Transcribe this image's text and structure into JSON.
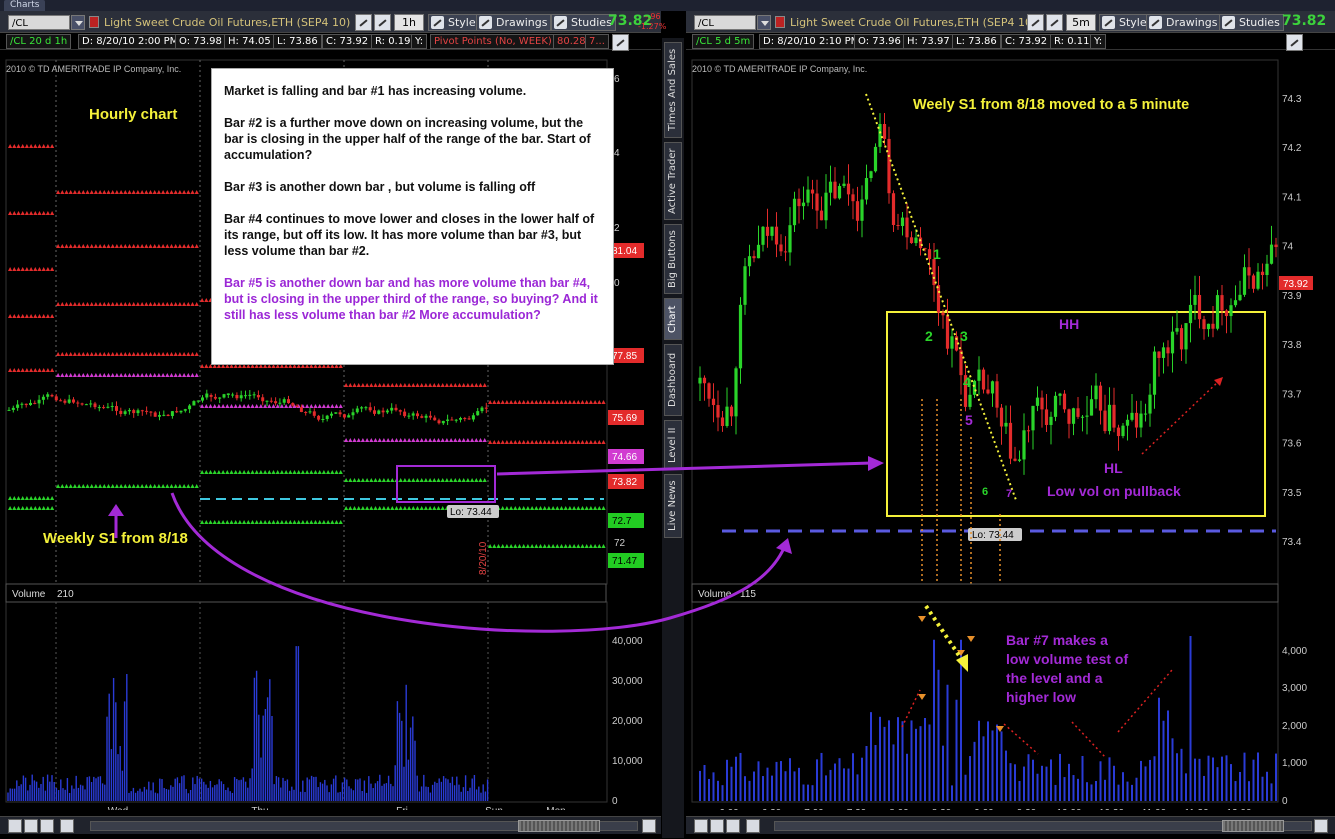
{
  "app": {
    "tab_label": "Charts"
  },
  "left": {
    "symbol": "/CL",
    "description": "Light Sweet Crude Oil Futures,ETH (SEP4 10)",
    "timeframe": "1h",
    "style_label": "Style",
    "drawings_label": "Drawings",
    "studies_label": "Studies",
    "last_price": "73.82",
    "change_top": "-.96",
    "change_bottom": "-1.27%",
    "info": {
      "aggregation": "/CL 20 d 1h",
      "date": "D: 8/20/10 2:00 PM",
      "open": "O: 73.98",
      "high": "H: 74.05",
      "low": "L: 73.86",
      "close": "C: 73.92",
      "range": "R: 0.19",
      "y": "Y:",
      "pivot": "Pivot Points (No, WEEK)",
      "pivot_v1": "80.28",
      "pivot_v2": "7..."
    },
    "copyright": "2010 © TD AMERITRADE IP Company, Inc.",
    "chart_label": "Hourly chart",
    "weekly_label": "Weekly S1 from 8/18",
    "date_marker": "8/20/10",
    "lo_label": "Lo: 73.44",
    "volume_label": "Volume",
    "volume_value": "210",
    "time_labels": [
      "Wed",
      "Thu",
      "Fri",
      "Sun",
      "Mon"
    ],
    "vol_axis": [
      "40,000",
      "30,000",
      "20,000",
      "10,000",
      "0"
    ],
    "pivot_tags": [
      {
        "v": "81.04",
        "c": "#e32b2b",
        "tc": "#fff"
      },
      {
        "v": "77.85",
        "c": "#e32b2b",
        "tc": "#fff"
      },
      {
        "v": "75.69",
        "c": "#e32b2b",
        "tc": "#fff"
      },
      {
        "v": "74.66",
        "c": "#d13bd1",
        "tc": "#fff"
      },
      {
        "v": "73.82",
        "c": "#e32b2b",
        "tc": "#fff"
      },
      {
        "v": "72.7",
        "c": "#22cc22",
        "tc": "#000"
      },
      {
        "v": "71.47",
        "c": "#22cc22",
        "tc": "#000"
      }
    ],
    "axis_fragments": [
      "6",
      "4",
      "2",
      "0",
      "72"
    ]
  },
  "callout": {
    "p1": "Market is falling and bar #1 has increasing volume.",
    "p2": "Bar #2 is a further move down on increasing volume, but the bar is closing in the upper half of the range of the bar.  Start of accumulation?",
    "p3": "Bar #3 is another down bar , but volume is falling off",
    "p4": "Bar #4 continues to move lower and closes in the lower half of its range, but off its low.  It has more volume than bar #3, but less volume than bar #2.",
    "p5": "Bar #5 is another down  bar and has more volume than bar #4, but is closing in the upper third of the range, so buying? And it still has less volume than bar #2  More accumulation?"
  },
  "side_tabs": [
    "Times And Sales",
    "Active Trader",
    "Big Buttons",
    "Chart",
    "Dashboard",
    "Level II",
    "Live News"
  ],
  "right": {
    "symbol": "/CL",
    "description": "Light Sweet Crude Oil Futures,ETH (SEP4 10)",
    "timeframe": "5m",
    "style_label": "Style",
    "drawings_label": "Drawings",
    "studies_label": "Studies",
    "last_price": "73.82",
    "info": {
      "aggregation": "/CL 5 d 5m",
      "date": "D: 8/20/10 2:10 PM",
      "open": "O: 73.96",
      "high": "H: 73.97",
      "low": "L: 73.86",
      "close": "C: 73.92",
      "range": "R: 0.11",
      "y": "Y:"
    },
    "copyright": "2010 © TD AMERITRADE IP Company, Inc.",
    "title_annotation": "Weely S1 from 8/18 moved to a 5 minute",
    "bar_numbers": [
      "1",
      "2",
      "3",
      "4",
      "5",
      "6",
      "7"
    ],
    "hh_label": "HH",
    "hl_label": "HL",
    "low_vol_label": "Low vol on pullback",
    "lo_label": "Lo: 73.44",
    "last_tag": "73.92",
    "price_axis": [
      "74.3",
      "74.2",
      "74.1",
      "74",
      "73.9",
      "73.8",
      "73.7",
      "73.6",
      "73.5",
      "73.4"
    ],
    "volume_label": "Volume",
    "volume_value": "115",
    "vol_axis": [
      "4,000",
      "3,000",
      "2,000",
      "1,000",
      "0"
    ],
    "time_labels": [
      "6:00",
      "6:30",
      "7:00",
      "7:30",
      "8:00",
      "8:30",
      "9:00",
      "9:30",
      "10:00",
      "10:30",
      "11:00",
      "11:30",
      "12:00"
    ],
    "bar7_note": [
      "Bar #7 makes a",
      "low volume test of",
      "the level and a",
      "higher low"
    ]
  },
  "chart_data": [
    {
      "type": "candlestick",
      "title": "Hourly chart",
      "x": [
        "Wed",
        "Thu",
        "Fri",
        "Sun",
        "Mon"
      ],
      "ylabel": "",
      "pivot_levels": [
        81.04,
        77.85,
        75.69,
        74.66,
        72.7,
        71.47
      ],
      "lo": 73.44,
      "volume_ylim": [
        0,
        45000
      ]
    },
    {
      "type": "candlestick",
      "title": "Weely S1 from 8/18 moved to a 5 minute",
      "x": [
        "6:00",
        "6:30",
        "7:00",
        "7:30",
        "8:00",
        "8:30",
        "9:00",
        "9:30",
        "10:00",
        "10:30",
        "11:00",
        "11:30",
        "12:00"
      ],
      "ylim": [
        73.4,
        74.3
      ],
      "support_level": 73.42,
      "lo": 73.44,
      "last": 73.92,
      "volume_ylim": [
        0,
        4400
      ]
    }
  ]
}
